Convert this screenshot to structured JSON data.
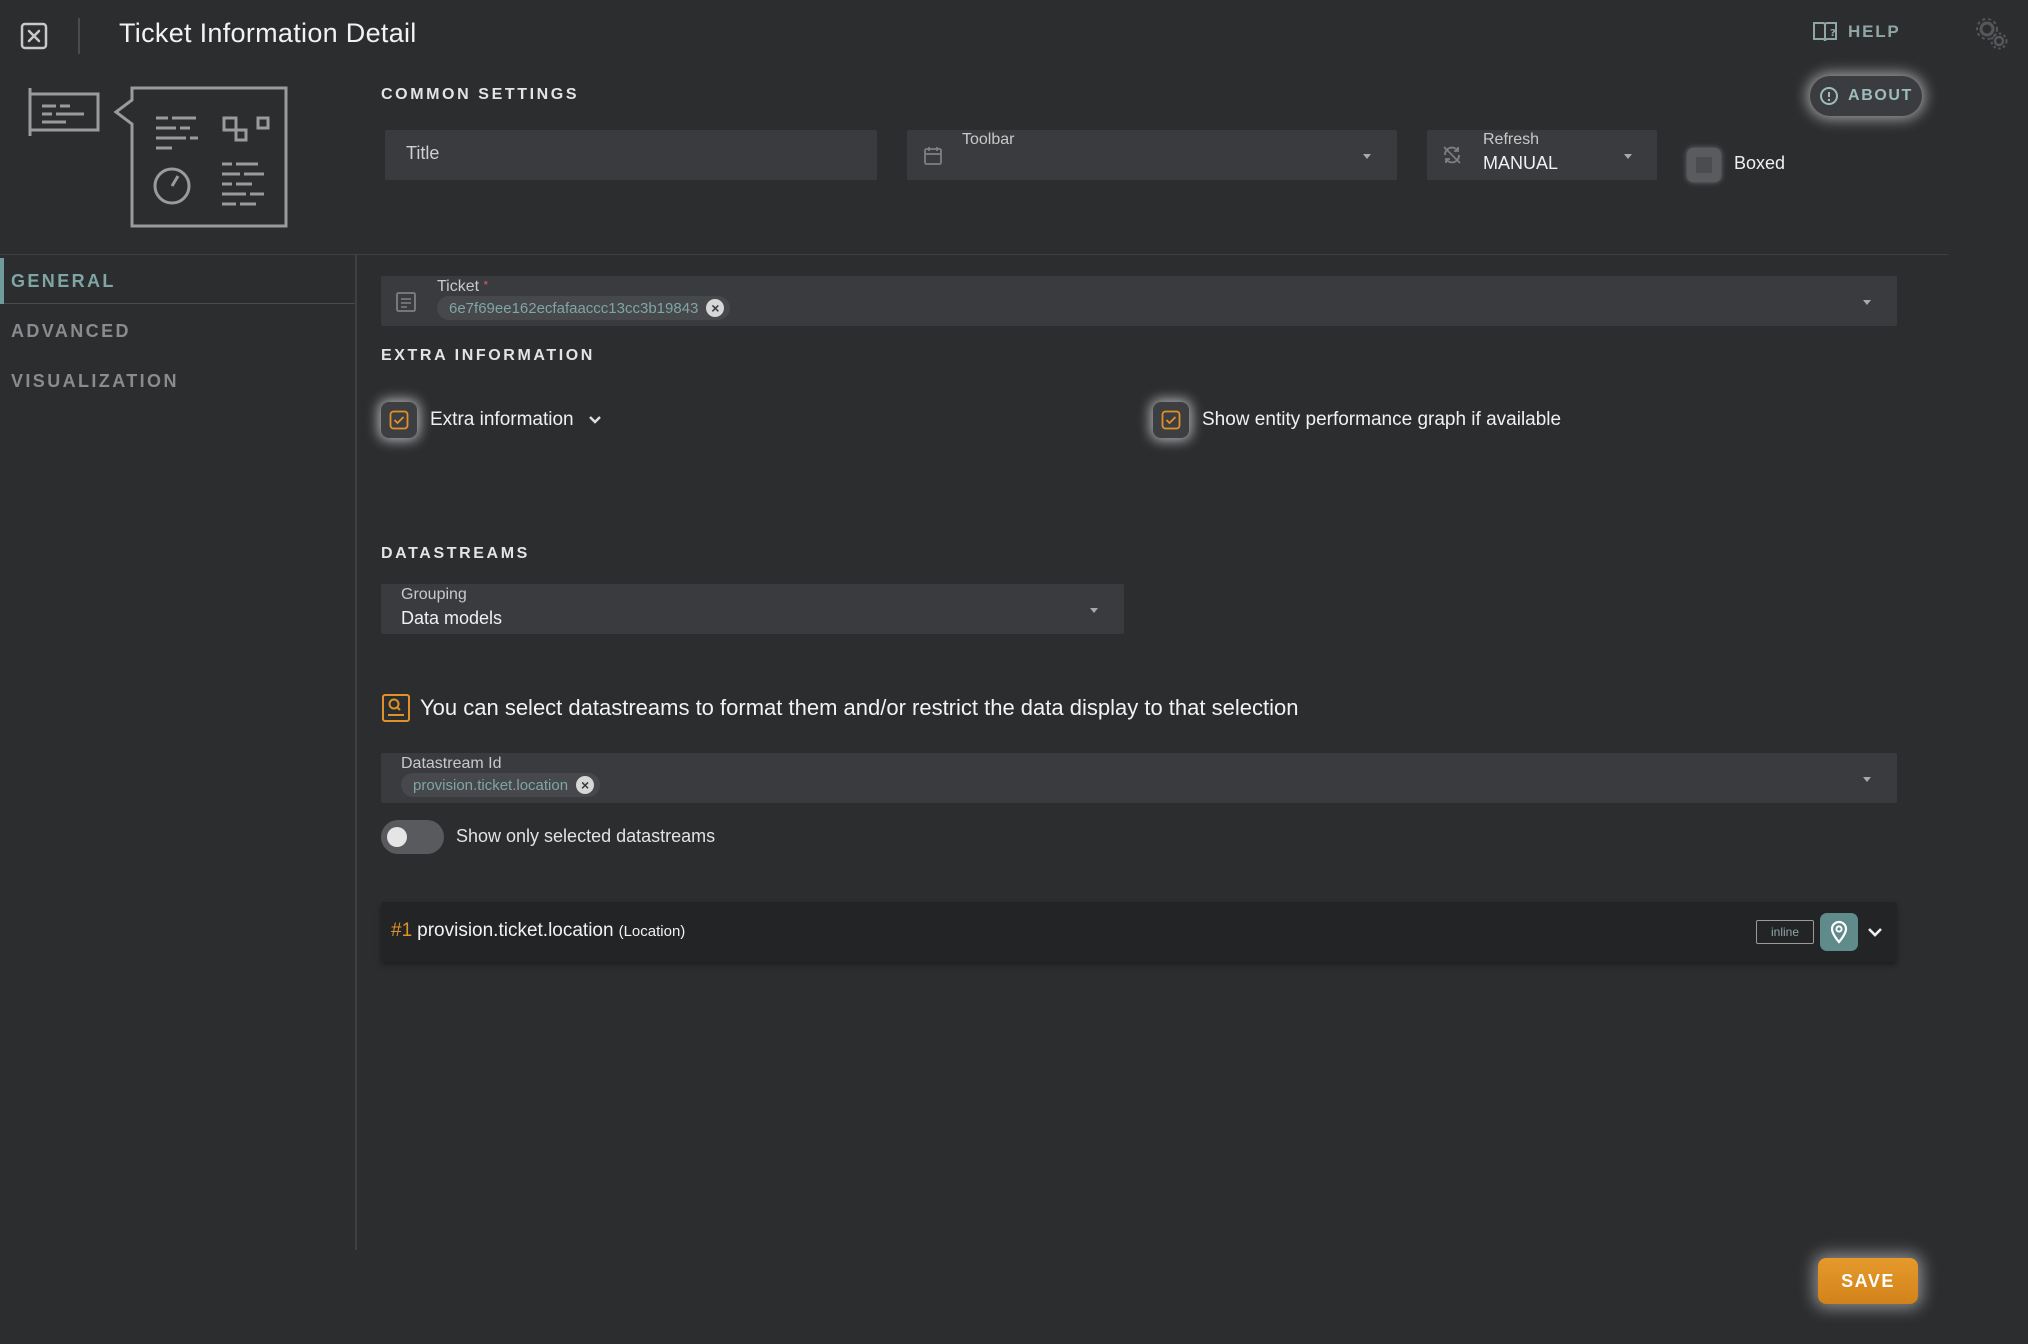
{
  "header": {
    "title": "Ticket Information Detail",
    "help_label": "HELP"
  },
  "nav": {
    "items": [
      {
        "label": "GENERAL",
        "active": true
      },
      {
        "label": "ADVANCED",
        "active": false
      },
      {
        "label": "VISUALIZATION",
        "active": false
      }
    ]
  },
  "common": {
    "section_title": "COMMON SETTINGS",
    "about_label": "ABOUT",
    "title_placeholder": "Title",
    "toolbar_label": "Toolbar",
    "toolbar_value": "",
    "refresh_label": "Refresh",
    "refresh_value": "MANUAL",
    "boxed_label": "Boxed"
  },
  "ticket": {
    "label": "Ticket",
    "required_mark": "*",
    "chip_value": "6e7f69ee162ecfafaaccc13cc3b19843"
  },
  "extra": {
    "section_title": "EXTRA INFORMATION",
    "extra_info_label": "Extra information",
    "perf_graph_label": "Show entity performance graph if available"
  },
  "datastreams": {
    "section_title": "DATASTREAMS",
    "grouping_label": "Grouping",
    "grouping_value": "Data models",
    "info_text": "You can select datastreams to format them and/or restrict the data display to that selection",
    "ds_id_label": "Datastream Id",
    "ds_id_chip": "provision.ticket.location",
    "toggle_label": "Show only selected datastreams",
    "toggle_on": false,
    "rows": [
      {
        "index": "#1",
        "name": "provision.ticket.location",
        "type": "(Location)",
        "badge": "inline"
      }
    ]
  },
  "footer": {
    "save_label": "SAVE"
  },
  "colors": {
    "accent_teal": "#7fa5a5",
    "accent_orange": "#e0922a",
    "background": "#2c2d2f"
  }
}
